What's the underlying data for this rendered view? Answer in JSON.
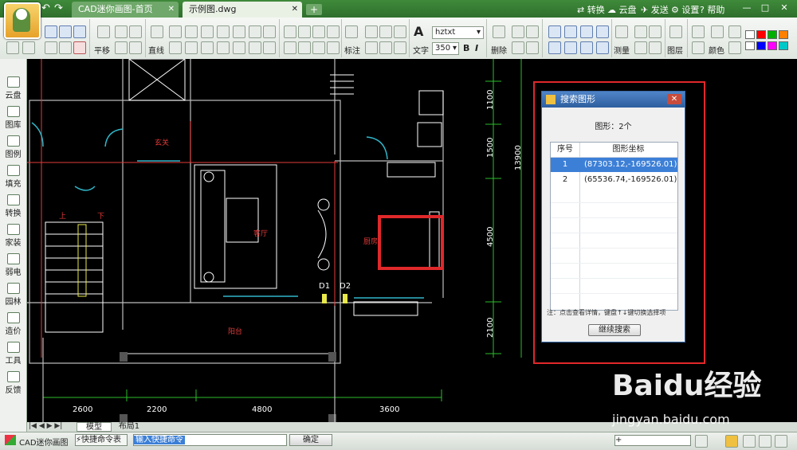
{
  "titlebar": {
    "tabs": [
      {
        "label": "CAD迷你画图-首页",
        "close": "✕"
      },
      {
        "label": "示例图.dwg",
        "close": "✕"
      }
    ],
    "add_tab": "+",
    "menu": [
      "转换",
      "云盘",
      "发送",
      "设置",
      "帮助"
    ],
    "window_controls": [
      "—",
      "□",
      "✕"
    ]
  },
  "ribbon": {
    "labels": {
      "pan": "平移",
      "line": "直线",
      "dimension": "标注",
      "text": "文字",
      "delete": "删除",
      "measure": "测量",
      "layer": "图层",
      "color": "颜色",
      "line_style": "线型"
    },
    "font_name": "hztxt",
    "font_size": "350",
    "bold": "B",
    "italic": "I",
    "palette": [
      "#ffffff",
      "#ff0000",
      "#00b000",
      "#ff8000",
      "#ffffff",
      "#0000ff",
      "#ff00ff",
      "#00c8c8",
      "#000000",
      "#808080"
    ]
  },
  "sidebar": {
    "items": [
      "云盘",
      "图库",
      "图例",
      "填充",
      "转换",
      "家装",
      "弱电",
      "园林",
      "造价",
      "工具",
      "反馈"
    ]
  },
  "drawing": {
    "room_labels": {
      "entrance": "玄关",
      "living": "客厅",
      "kitchen": "厨房",
      "balcony": "阳台",
      "up": "上",
      "down": "下",
      "door_d1": "D1",
      "door_d2": "D2"
    },
    "dimensions_bottom": [
      "2600",
      "2200",
      "4800",
      "3600"
    ],
    "dimensions_right": [
      "1100",
      "1500",
      "4500",
      "2100"
    ],
    "dimension_total": "13900"
  },
  "dialog": {
    "title": "搜索图形",
    "count_text": "图形：2个",
    "columns": [
      "序号",
      "图形坐标"
    ],
    "rows": [
      {
        "index": "1",
        "coord": "(87303.12,-169526.01)",
        "selected": true
      },
      {
        "index": "2",
        "coord": "(65536.74,-169526.01)",
        "selected": false
      }
    ],
    "note": "注：点击查看详情，键盘↑↓键切换选择项",
    "button": "继续搜索",
    "close": "✕"
  },
  "layout_tabs": [
    "模型",
    "布局1"
  ],
  "statusbar": {
    "app_name": "CAD迷你画图",
    "shortcut": "快捷命令表",
    "command_placeholder": "输入快捷命令",
    "ok": "确定"
  },
  "watermark": {
    "logo": "Baidu经验",
    "url": "jingyan.baidu.com"
  }
}
